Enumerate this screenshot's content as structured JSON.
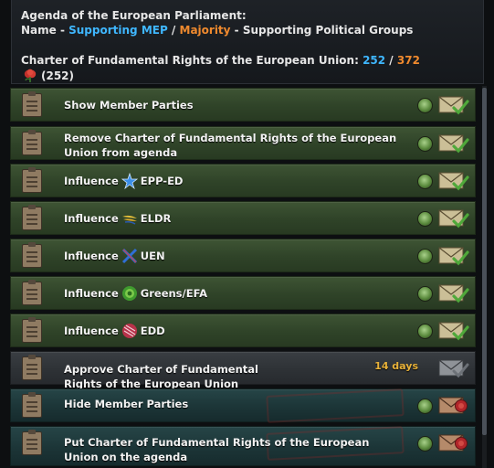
{
  "header": {
    "title": "Agenda of the European Parliament:",
    "legend_name": "Name - ",
    "legend_mep": "Supporting MEP",
    "legend_sep": " / ",
    "legend_majority": "Majority",
    "legend_rest": " - Supporting Political Groups",
    "charter_label": "Charter of Fundamental Rights of the European Union: ",
    "charter_mep": "252",
    "charter_slash": " / ",
    "charter_majority": "372",
    "rose_count": "(252)"
  },
  "rows": [
    {
      "label": "Show Member Parties",
      "style": "green",
      "icon": "envelope-check-icon"
    },
    {
      "label_line1": "Remove Charter of Fundamental Rights of the European",
      "label_line2": "Union from agenda",
      "style": "green",
      "icon": "envelope-check-icon"
    },
    {
      "label": "Influence",
      "party": "EPP-ED",
      "party_icon": "epp-star-icon",
      "style": "green",
      "icon": "envelope-check-icon"
    },
    {
      "label": "Influence",
      "party": "ELDR",
      "party_icon": "eldr-wings-icon",
      "style": "green",
      "icon": "envelope-check-icon"
    },
    {
      "label": "Influence",
      "party": "UEN",
      "party_icon": "uen-cross-icon",
      "style": "green",
      "icon": "envelope-check-icon"
    },
    {
      "label": "Influence",
      "party": "Greens/EFA",
      "party_icon": "greens-sunflower-icon",
      "style": "green",
      "icon": "envelope-check-icon"
    },
    {
      "label": "Influence",
      "party": "EDD",
      "party_icon": "edd-pattern-icon",
      "style": "green",
      "icon": "envelope-check-icon"
    },
    {
      "label_line1": "Approve Charter of Fundamental",
      "label_line2": "Rights of the European Union",
      "days": "14 days",
      "style": "grey",
      "icon": "envelope-grey-icon"
    },
    {
      "label": "Hide Member Parties",
      "style": "teal",
      "icon": "envelope-red-seal-icon"
    },
    {
      "label_line1": "Put Charter of Fundamental Rights of the European",
      "label_line2": "Union on the agenda",
      "style": "teal",
      "icon": "envelope-red-seal-icon"
    }
  ],
  "colors": {
    "mep_blue": "#3fb7ff",
    "majority_orange": "#f08a2e",
    "days_gold": "#e8b23a"
  }
}
